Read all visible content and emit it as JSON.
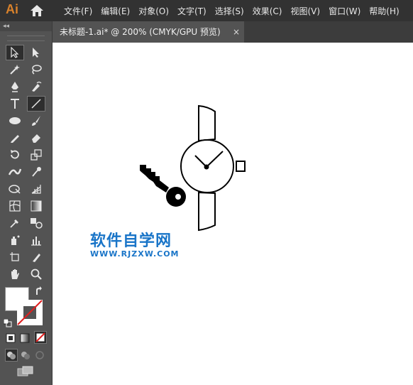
{
  "app": {
    "logo": "Ai"
  },
  "menu": [
    {
      "label": "文件(F)"
    },
    {
      "label": "编辑(E)"
    },
    {
      "label": "对象(O)"
    },
    {
      "label": "文字(T)"
    },
    {
      "label": "选择(S)"
    },
    {
      "label": "效果(C)"
    },
    {
      "label": "视图(V)"
    },
    {
      "label": "窗口(W)"
    },
    {
      "label": "帮助(H)"
    }
  ],
  "document_tab": {
    "title": "未标题-1.ai* @ 200% (CMYK/GPU 预览)",
    "close": "×"
  },
  "toolpanel": {
    "collapse": "◂◂"
  },
  "tools": [
    "selection-tool",
    "direct-selection-tool",
    "magic-wand-tool",
    "lasso-tool",
    "pen-tool",
    "curvature-tool",
    "type-tool",
    "line-segment-tool",
    "ellipse-tool",
    "paintbrush-tool",
    "pencil-tool",
    "eraser-tool",
    "rotate-tool",
    "scale-tool",
    "width-tool",
    "puppet-warp-tool",
    "shape-builder-tool",
    "perspective-grid-tool",
    "mesh-tool",
    "gradient-tool",
    "eyedropper-tool",
    "blend-tool",
    "symbol-sprayer-tool",
    "column-graph-tool",
    "artboard-tool",
    "slice-tool",
    "hand-tool",
    "zoom-tool"
  ],
  "watermark": {
    "title": "软件自学网",
    "url": "WWW.RJZXW.COM"
  },
  "colors": {
    "menubar": "#323232",
    "panel": "#535353",
    "canvas": "#ffffff",
    "watermark": "#1a75c8",
    "logo": "#d9822b"
  }
}
